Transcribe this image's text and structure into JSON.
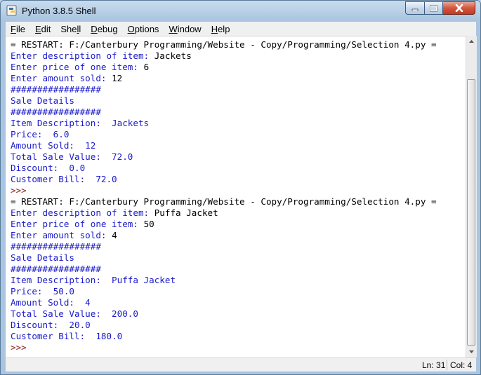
{
  "window": {
    "title": "Python 3.8.5 Shell"
  },
  "menu": [
    "File",
    "Edit",
    "Shell",
    "Debug",
    "Options",
    "Window",
    "Help"
  ],
  "console_lines": [
    {
      "type": "prompt",
      "text": ">>>"
    },
    {
      "type": "input",
      "text": "= RESTART: F:/Canterbury Programming/Website - Copy/Programming/Selection 4.py ="
    },
    {
      "type": "output",
      "text": "Enter description of item: ",
      "input": "Jackets"
    },
    {
      "type": "output",
      "text": "Enter price of one item: ",
      "input": "6"
    },
    {
      "type": "output",
      "text": "Enter amount sold: ",
      "input": "12"
    },
    {
      "type": "output",
      "text": "#################"
    },
    {
      "type": "output",
      "text": "Sale Details"
    },
    {
      "type": "output",
      "text": "#################"
    },
    {
      "type": "output",
      "text": "Item Description:  Jackets"
    },
    {
      "type": "output",
      "text": "Price:  6.0"
    },
    {
      "type": "output",
      "text": "Amount Sold:  12"
    },
    {
      "type": "output",
      "text": "Total Sale Value:  72.0"
    },
    {
      "type": "output",
      "text": "Discount:  0.0"
    },
    {
      "type": "output",
      "text": "Customer Bill:  72.0"
    },
    {
      "type": "prompt",
      "text": ">>>"
    },
    {
      "type": "input",
      "text": "= RESTART: F:/Canterbury Programming/Website - Copy/Programming/Selection 4.py ="
    },
    {
      "type": "output",
      "text": "Enter description of item: ",
      "input": "Puffa Jacket"
    },
    {
      "type": "output",
      "text": "Enter price of one item: ",
      "input": "50"
    },
    {
      "type": "output",
      "text": "Enter amount sold: ",
      "input": "4"
    },
    {
      "type": "output",
      "text": "#################"
    },
    {
      "type": "output",
      "text": "Sale Details"
    },
    {
      "type": "output",
      "text": "#################"
    },
    {
      "type": "output",
      "text": "Item Description:  Puffa Jacket"
    },
    {
      "type": "output",
      "text": "Price:  50.0"
    },
    {
      "type": "output",
      "text": "Amount Sold:  4"
    },
    {
      "type": "output",
      "text": "Total Sale Value:  200.0"
    },
    {
      "type": "output",
      "text": "Discount:  20.0"
    },
    {
      "type": "output",
      "text": "Customer Bill:  180.0"
    },
    {
      "type": "prompt",
      "text": ">>>"
    }
  ],
  "status": {
    "line": "Ln: 31",
    "col": "Col: 4"
  },
  "colors": {
    "prompt": "#8b1e1e",
    "output": "#1a1acc",
    "input": "#000000"
  },
  "icons": {
    "app": "python-idle-icon",
    "minimize": "minimize-icon",
    "maximize": "maximize-icon",
    "close": "close-icon"
  }
}
